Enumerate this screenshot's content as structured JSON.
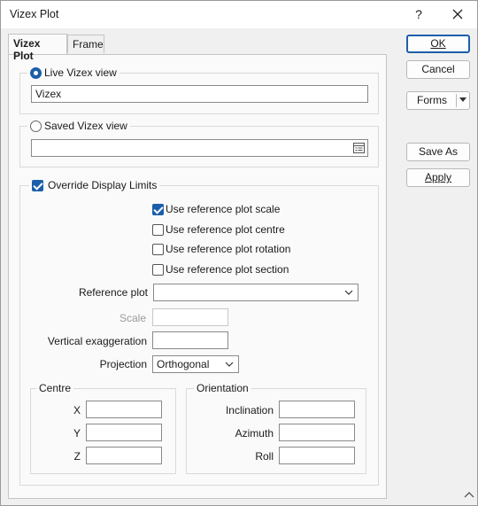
{
  "window": {
    "title": "Vizex Plot",
    "help": "?"
  },
  "tabs": [
    {
      "label": "Vizex Plot"
    },
    {
      "label": "Frame"
    }
  ],
  "live_view": {
    "label": "Live Vizex view",
    "selected": true,
    "value": "Vizex"
  },
  "saved_view": {
    "label": "Saved Vizex view",
    "selected": false,
    "value": ""
  },
  "override": {
    "label": "Override Display Limits",
    "checked": true,
    "options": [
      {
        "label": "Use reference plot scale",
        "checked": true
      },
      {
        "label": "Use reference plot centre",
        "checked": false
      },
      {
        "label": "Use reference plot rotation",
        "checked": false
      },
      {
        "label": "Use reference plot section",
        "checked": false
      }
    ],
    "reference_plot": {
      "label": "Reference plot",
      "value": ""
    },
    "scale": {
      "label": "Scale",
      "value": ""
    },
    "vertical_exaggeration": {
      "label": "Vertical exaggeration",
      "value": ""
    },
    "projection": {
      "label": "Projection",
      "value": "Orthogonal"
    },
    "centre": {
      "title": "Centre",
      "x": {
        "label": "X",
        "value": ""
      },
      "y": {
        "label": "Y",
        "value": ""
      },
      "z": {
        "label": "Z",
        "value": ""
      }
    },
    "orientation": {
      "title": "Orientation",
      "inclination": {
        "label": "Inclination",
        "value": ""
      },
      "azimuth": {
        "label": "Azimuth",
        "value": ""
      },
      "roll": {
        "label": "Roll",
        "value": ""
      }
    }
  },
  "buttons": {
    "ok": "OK",
    "cancel": "Cancel",
    "forms": "Forms",
    "save_as": "Save As",
    "apply": "Apply"
  }
}
